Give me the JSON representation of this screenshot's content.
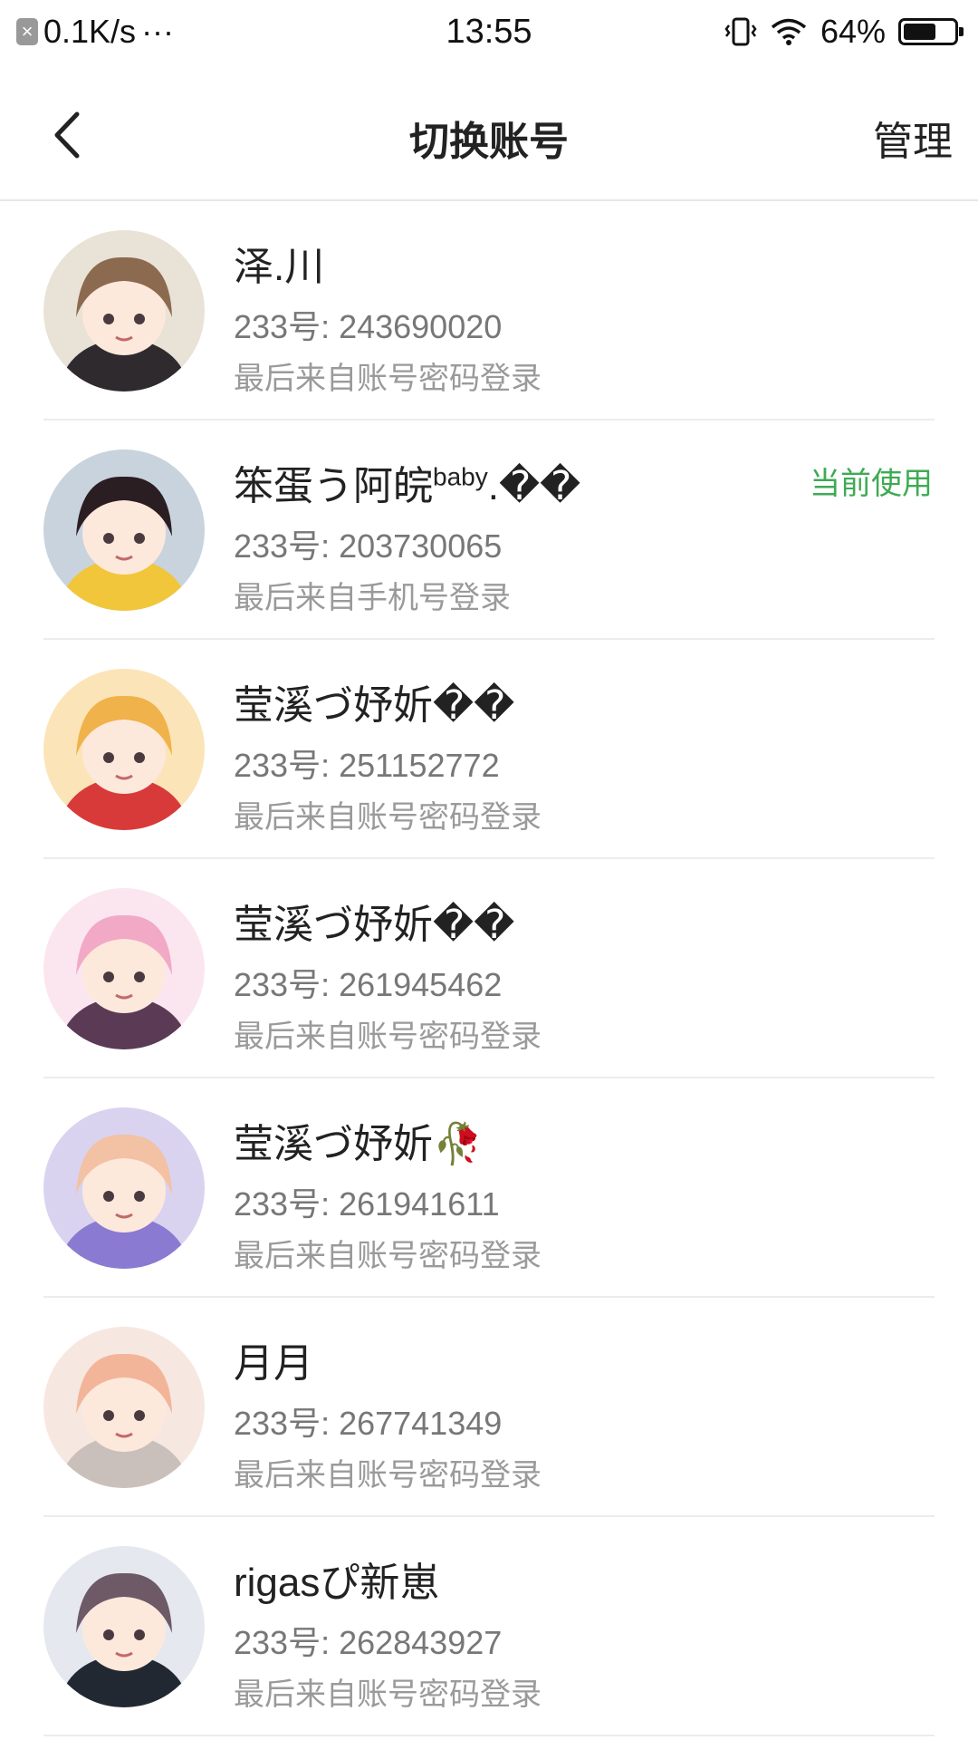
{
  "status_bar": {
    "net_icon": "x-badge-icon",
    "speed": "0.1K/s",
    "more": "···",
    "time": "13:55",
    "battery_percent": "64%",
    "battery_level": 0.64
  },
  "nav": {
    "back_icon": "chevron-left-icon",
    "title": "切换账号",
    "manage_label": "管理"
  },
  "accounts": [
    {
      "name": "泽.川",
      "name_sup": "",
      "name_suffix": "",
      "id_label": "233号: 243690020",
      "login_text": "最后来自账号密码登录",
      "current": false
    },
    {
      "name": "笨蛋う阿皖",
      "name_sup": "baby",
      "name_suffix": ".��",
      "id_label": "233号: 203730065",
      "login_text": "最后来自手机号登录",
      "current": true,
      "current_label": "当前使用"
    },
    {
      "name": "莹溪づ妤妡��",
      "name_sup": "",
      "name_suffix": "",
      "id_label": "233号: 251152772",
      "login_text": "最后来自账号密码登录",
      "current": false
    },
    {
      "name": "莹溪づ妤妡��",
      "name_sup": "",
      "name_suffix": "",
      "id_label": "233号: 261945462",
      "login_text": "最后来自账号密码登录",
      "current": false
    },
    {
      "name": "莹溪づ妤妡🥀",
      "name_sup": "",
      "name_suffix": "",
      "id_label": "233号: 261941611",
      "login_text": "最后来自账号密码登录",
      "current": false
    },
    {
      "name": "月月",
      "name_sup": "",
      "name_suffix": "",
      "id_label": "233号: 267741349",
      "login_text": "最后来自账号密码登录",
      "current": false
    },
    {
      "name": "rigasぴ新崽",
      "name_sup": "",
      "name_suffix": "",
      "id_label": "233号: 262843927",
      "login_text": "最后来自账号密码登录",
      "current": false
    }
  ],
  "colors": {
    "accent_green": "#3eab53",
    "avatar_palette": [
      [
        "#8c6a4f",
        "#e9e2d6",
        "#2f2a2e"
      ],
      [
        "#2b1e22",
        "#c9d3de",
        "#f1c63a"
      ],
      [
        "#f0b24a",
        "#fbe4b8",
        "#d83a3a"
      ],
      [
        "#f2a9c6",
        "#fbe6ef",
        "#5b3a55"
      ],
      [
        "#f3c1a4",
        "#d9d3f0",
        "#8a7ad1"
      ],
      [
        "#f3b59a",
        "#f6e8e0",
        "#c9c0bb"
      ],
      [
        "#6d5a66",
        "#e6e8ef",
        "#222831"
      ]
    ]
  }
}
